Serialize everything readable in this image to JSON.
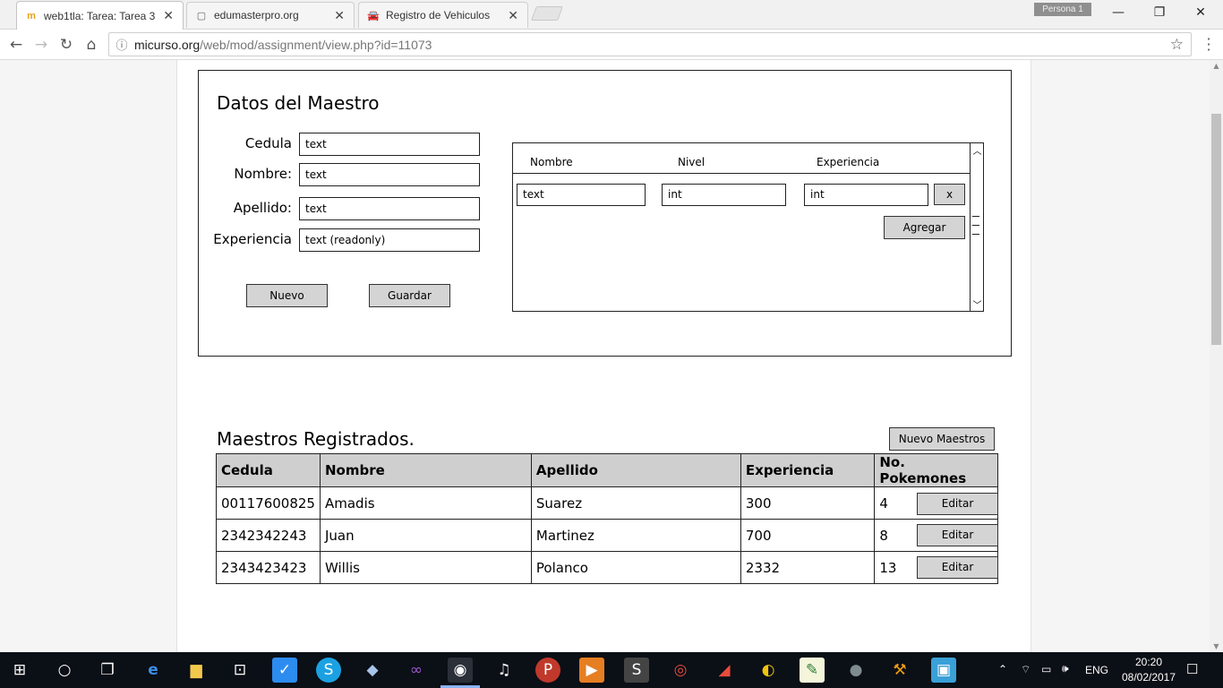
{
  "browser": {
    "tabs": [
      {
        "label": "web1tla: Tarea: Tarea 3",
        "favicon": "moodle-icon",
        "active": true
      },
      {
        "label": "edumasterpro.org",
        "favicon": "page-icon",
        "active": false
      },
      {
        "label": "Registro de Vehiculos",
        "favicon": "car-icon",
        "active": false
      }
    ],
    "profile": "Persona 1",
    "url_host": "micurso.org",
    "url_path": "/web/mod/assignment/view.php?id=11073"
  },
  "maestro": {
    "title": "Datos del Maestro",
    "fields": [
      {
        "label": "Cedula",
        "value": "text"
      },
      {
        "label": "Nombre:",
        "value": "text"
      },
      {
        "label": "Apellido:",
        "value": "text"
      },
      {
        "label": "Experiencia",
        "value": "text (readonly)"
      }
    ],
    "nuevo_label": "Nuevo",
    "guardar_label": "Guardar"
  },
  "pokemon_table": {
    "headers": [
      "Nombre",
      "Nivel",
      "Experiencia"
    ],
    "row": [
      "text",
      "int",
      "int"
    ],
    "remove_label": "x",
    "add_label": "Agregar"
  },
  "registered": {
    "title": "Maestros Registrados.",
    "new_label": "Nuevo Maestros",
    "headers": [
      "Cedula",
      "Nombre",
      "Apellido",
      "Experiencia",
      "No. Pokemones"
    ],
    "rows": [
      [
        "00117600825",
        "Amadis",
        "Suarez",
        "300",
        "4"
      ],
      [
        "2342342243",
        "Juan",
        "Martinez",
        "700",
        "8"
      ],
      [
        "2343423423",
        "Willis",
        "Polanco",
        "2332",
        "13"
      ]
    ],
    "edit_label": "Editar"
  },
  "taskbar": {
    "lang": "ENG",
    "time": "20:20",
    "date": "08/02/2017"
  }
}
